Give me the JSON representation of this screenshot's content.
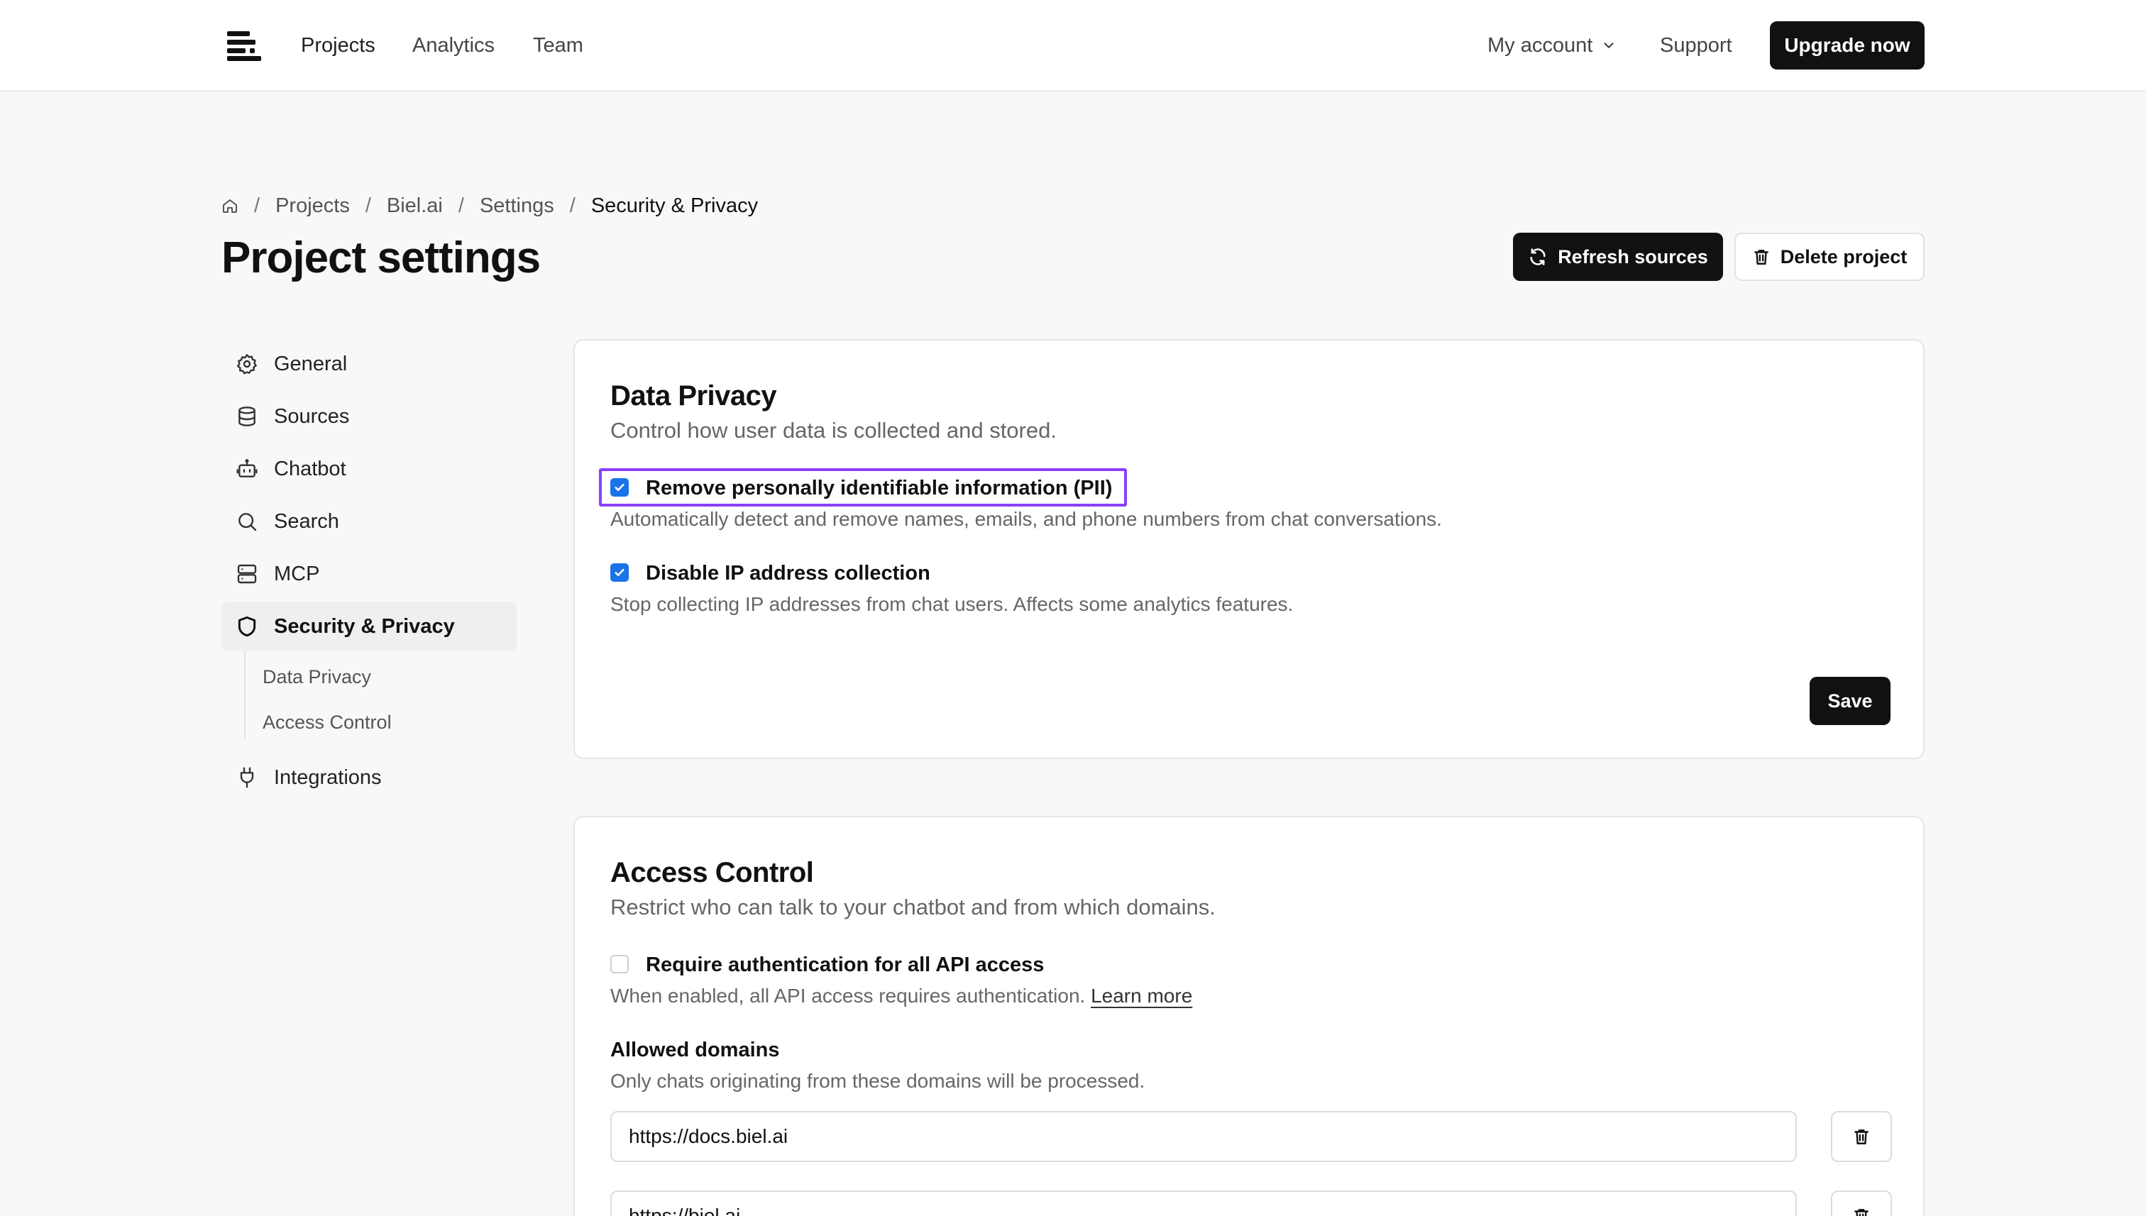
{
  "header": {
    "logo_icon": "lines-logo-icon",
    "nav": {
      "projects": "Projects",
      "analytics": "Analytics",
      "team": "Team"
    },
    "account_label": "My account",
    "support_label": "Support",
    "upgrade_label": "Upgrade now"
  },
  "breadcrumb": {
    "home_icon": "home-icon",
    "sep": "/",
    "items": [
      "Projects",
      "Biel.ai",
      "Settings",
      "Security & Privacy"
    ]
  },
  "page": {
    "title": "Project settings",
    "refresh_label": "Refresh sources",
    "delete_label": "Delete project"
  },
  "sidebar": {
    "items": [
      {
        "label": "General",
        "icon": "gear-icon"
      },
      {
        "label": "Sources",
        "icon": "database-icon"
      },
      {
        "label": "Chatbot",
        "icon": "robot-icon"
      },
      {
        "label": "Search",
        "icon": "search-icon"
      },
      {
        "label": "MCP",
        "icon": "server-icon"
      },
      {
        "label": "Security & Privacy",
        "icon": "shield-icon",
        "active": true
      },
      {
        "label": "Integrations",
        "icon": "plug-icon"
      }
    ],
    "sub_items": [
      "Data Privacy",
      "Access Control"
    ]
  },
  "data_privacy": {
    "title": "Data Privacy",
    "subtitle": "Control how user data is collected and stored.",
    "options": [
      {
        "label": "Remove personally identifiable information (PII)",
        "description": "Automatically detect and remove names, emails, and phone numbers from chat conversations.",
        "checked": true
      },
      {
        "label": "Disable IP address collection",
        "description": "Stop collecting IP addresses from chat users. Affects some analytics features.",
        "checked": true
      }
    ],
    "save_label": "Save"
  },
  "access_control": {
    "title": "Access Control",
    "subtitle": "Restrict who can talk to your chatbot and from which domains.",
    "auth_label": "Require authentication for all API access",
    "auth_checked": false,
    "auth_desc": "When enabled, all API access requires authentication.",
    "learn_more": "Learn more",
    "domains_label": "Allowed domains",
    "domains_desc": "Only chats originating from these domains will be processed.",
    "domains": [
      "https://docs.biel.ai",
      "https://biel.ai"
    ]
  },
  "colors": {
    "accent": "#1a73e8",
    "highlight": "#8a3ffc",
    "button_dark": "#111111",
    "background": "#f8f8f8"
  }
}
